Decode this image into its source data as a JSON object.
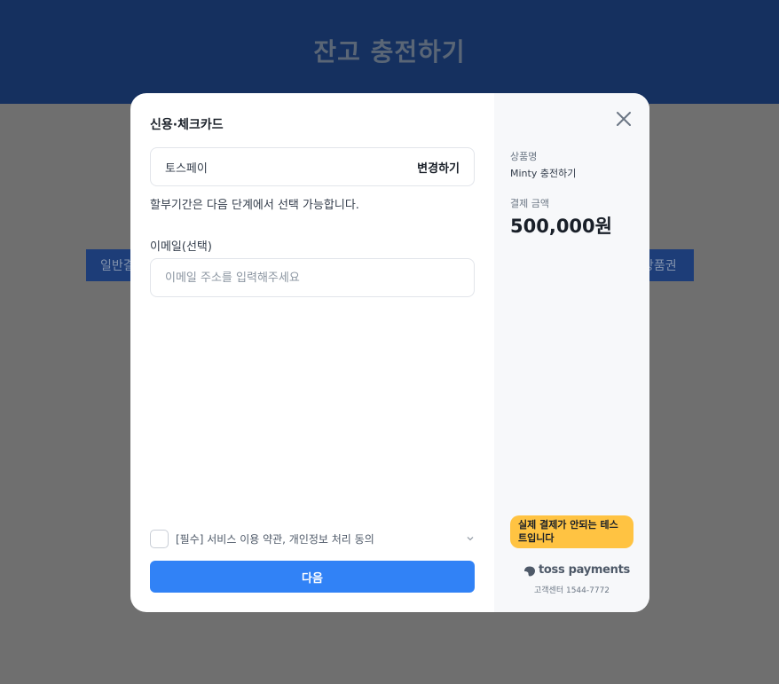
{
  "background": {
    "title": "잔고 충전하기",
    "left_button_label": "일반결",
    "right_button_label": "상품권"
  },
  "modal": {
    "section_title": "신용·체크카드",
    "payment_method": {
      "name": "토스페이",
      "change_label": "변경하기"
    },
    "installment_note": "할부기간은 다음 단계에서 선택 가능합니다.",
    "email": {
      "label": "이메일(선택)",
      "value": "",
      "placeholder": "이메일 주소를 입력해주세요"
    },
    "agreement": {
      "checked": false,
      "label": "[필수] 서비스 이용 약관, 개인정보 처리 동의",
      "chevron_icon": "chevron-down-icon"
    },
    "next_button_label": "다음",
    "side": {
      "close_icon": "close-icon",
      "product_label": "상품명",
      "product_name": "Minty 충전하기",
      "amount_label": "결제 금액",
      "amount_value": "500,000원",
      "test_badge": "실제 결제가 안되는 테스트입니다",
      "brand_name": "toss payments",
      "support_text": "고객센터 1544-7772"
    }
  },
  "colors": {
    "primary": "#3182f6",
    "header_bg": "#15305f",
    "badge": "#ffc342",
    "side_bg": "#f7f8fa"
  }
}
